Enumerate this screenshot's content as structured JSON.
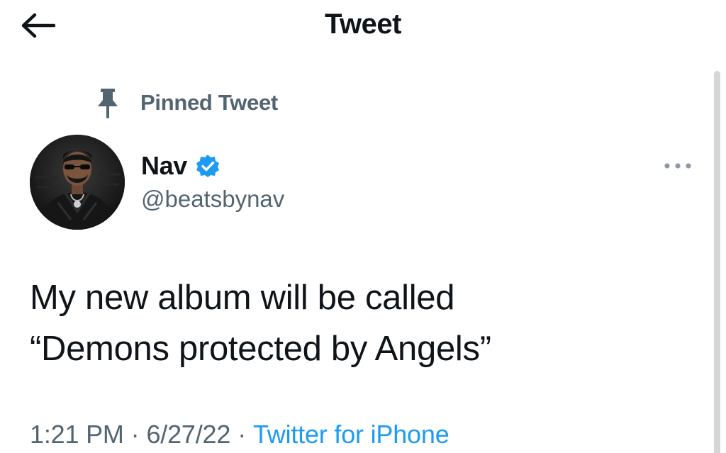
{
  "header": {
    "title": "Tweet",
    "back_icon": "arrow-left-icon"
  },
  "pinned": {
    "label": "Pinned Tweet",
    "icon": "pin-icon"
  },
  "author": {
    "display_name": "Nav",
    "handle": "@beatsbynav",
    "verified": true,
    "verified_icon": "verified-badge-icon"
  },
  "tweet": {
    "line1": "My new album will be called",
    "line2": "“Demons protected by Angels”"
  },
  "meta": {
    "time": "1:21 PM",
    "separator": "·",
    "date": "6/27/22",
    "source": "Twitter for iPhone"
  },
  "more_icon": "more-horizontal-icon",
  "colors": {
    "text_primary": "#0f1419",
    "text_secondary": "#536471",
    "accent": "#1d9bf0",
    "background": "#ffffff"
  }
}
